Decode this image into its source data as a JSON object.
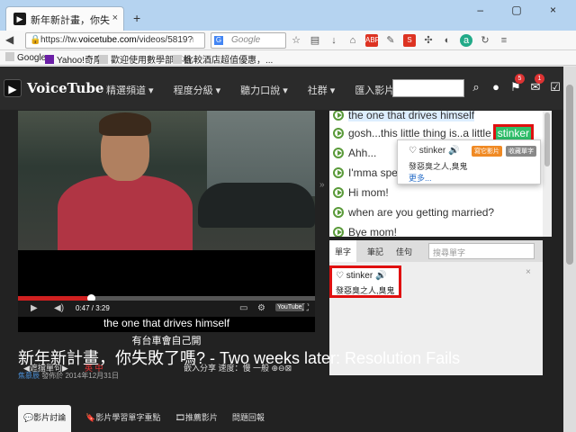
{
  "browser": {
    "tab_title": "新年新計畫，你失敗了嗎? ...",
    "tab_close": "×",
    "new_tab": "+",
    "window_controls": "– ▢ ×",
    "url_prefix": "https://tw.",
    "url_domain": "voicetube.com",
    "url_rest": "/videos/5819?ref=tra",
    "search_placeholder": "Google",
    "bookmarks": [
      "Google",
      "Yahoo!奇摩",
      "歡迎使用數學部落格",
      "比較酒店超值優惠，..."
    ]
  },
  "site": {
    "brand": "VoiceTube",
    "menu": [
      "精選頻道 ▾",
      "程度分級 ▾",
      "聽力口說 ▾",
      "社群 ▾",
      "匯入影片"
    ],
    "badges": {
      "mail": "5",
      "check": "1"
    }
  },
  "player": {
    "progress": 0.245,
    "time": "0:47 / 3:29",
    "sub_en": "the one that drives himself",
    "sub_zh": "有台車會自己開",
    "bottom_left": "◀遮擋單句▶",
    "lang_label": "英  中",
    "bottom_right": "嵌入分享  速度：慢  一般  ⊕⊖⊠",
    "yt": "YouTube"
  },
  "transcript": {
    "lines": [
      "the one that drives himself",
      "gosh...this little thing is..a little",
      "Ahh...",
      "I'mma spe",
      "Hi mom!",
      "when are you getting married?",
      "Bye mom!"
    ],
    "highlight": "stinker",
    "popup": {
      "word": "♡  stinker  🔊",
      "tag1": "寫它影片",
      "tag2": "收藏單字",
      "meaning": "發惡臭之人,臭鬼",
      "more": "更多..."
    }
  },
  "wordpanel": {
    "tabs": [
      "單字",
      "筆記",
      "佳句"
    ],
    "search_placeholder": "搜尋單字",
    "card_word": "♡ stinker  🔊",
    "card_meaning": "發惡臭之人,臭鬼",
    "close": "×"
  },
  "page": {
    "title": "新年新計畫，你失敗了嗎? - Two weeks later: Resolution Fails",
    "author": "焦慕辰",
    "date_text": " 發佈於 2014年12月31日",
    "bottom_tabs": [
      "💬影片討論",
      "🔖影片學習單字重點",
      "🎞推薦影片",
      "問題回報"
    ]
  }
}
